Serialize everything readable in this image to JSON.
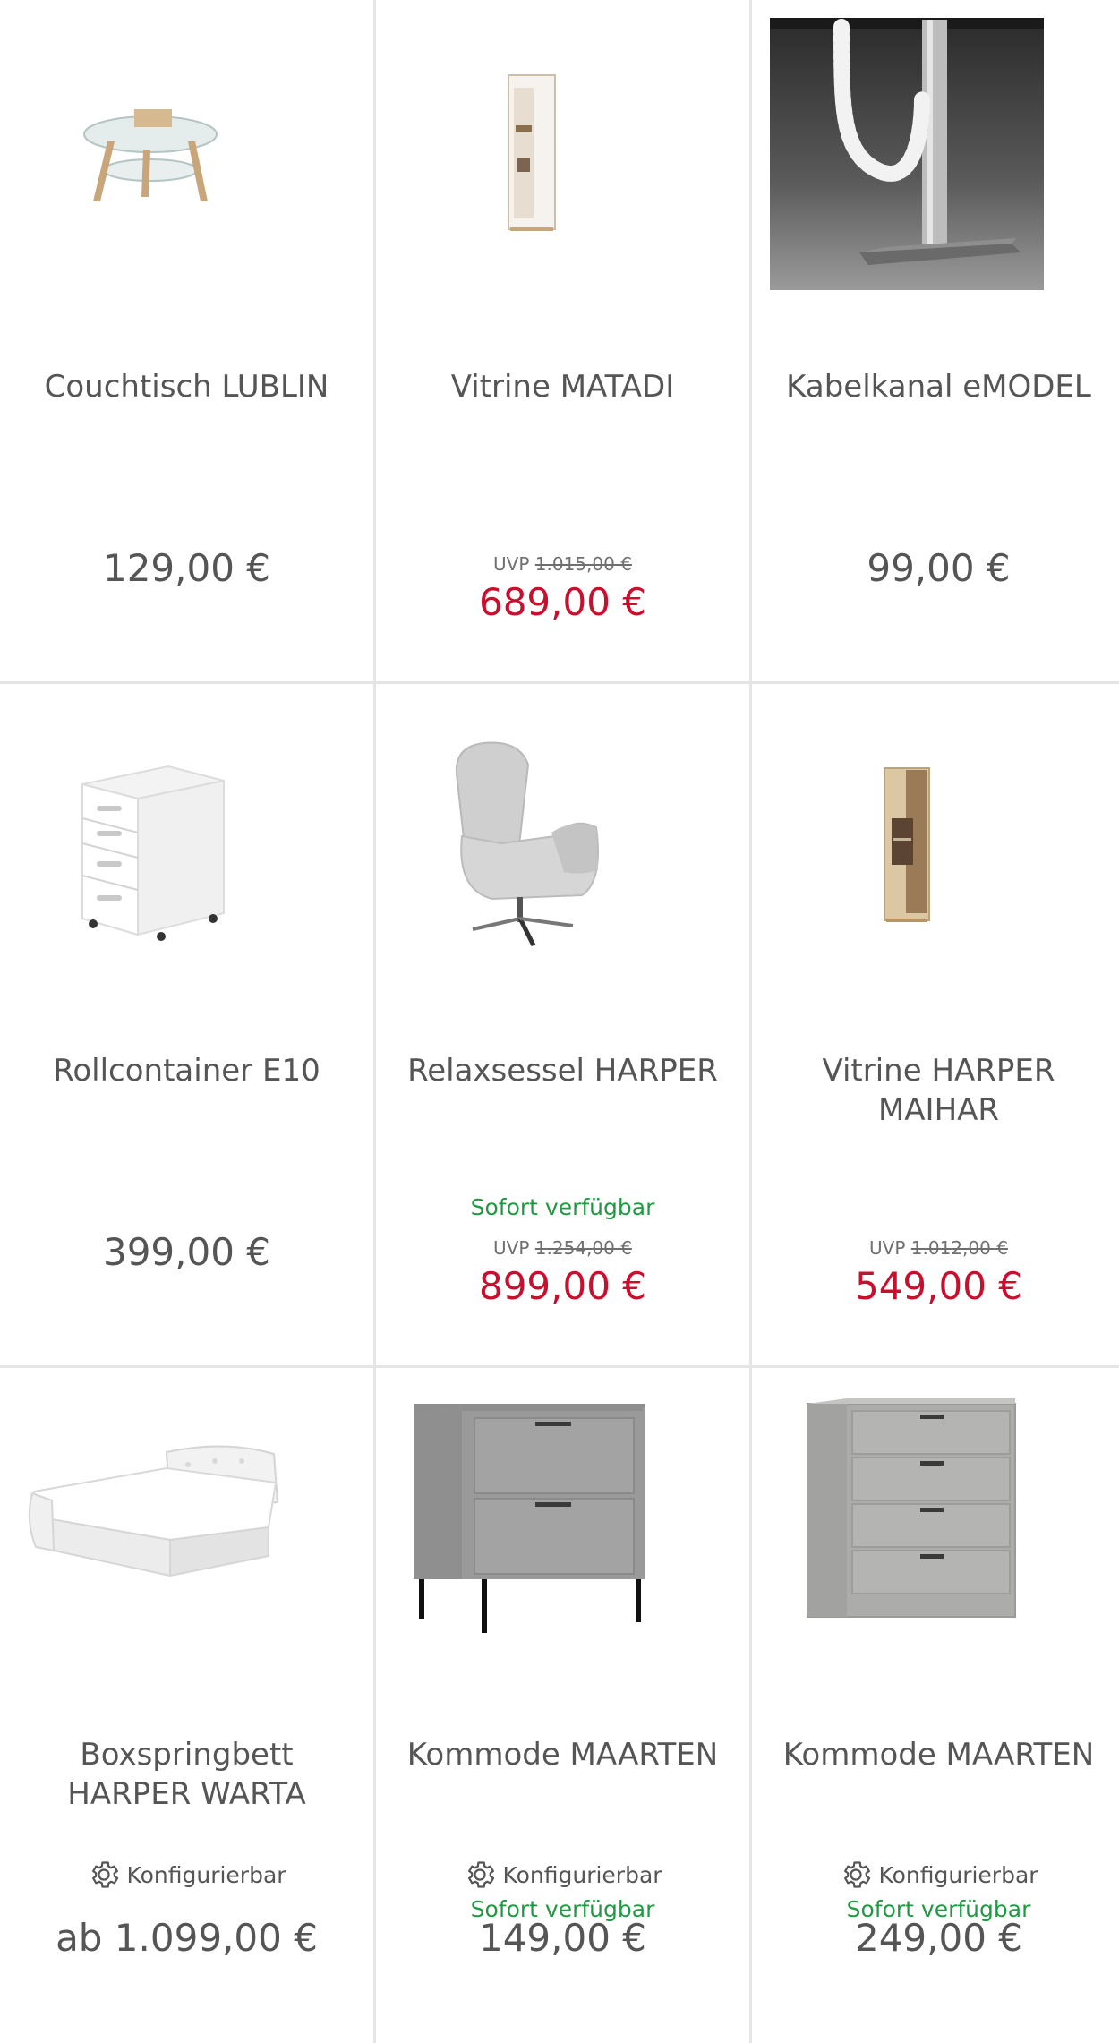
{
  "colors": {
    "sale": "#c8102e",
    "available": "#1f9a42",
    "text": "#555555",
    "divider": "#e5e5e5"
  },
  "labels": {
    "uvp": "UVP",
    "configurable": "Konfigurierbar",
    "available": "Sofort verfügbar"
  },
  "products": [
    {
      "title": "Couchtisch LUBLIN",
      "price": "129,00 €",
      "image": "glass-coffee-table"
    },
    {
      "title": "Vitrine MATADI",
      "uvp_price": "1.015,00 €",
      "sale_price": "689,00 €",
      "image": "white-display-cabinet"
    },
    {
      "title": "Kabelkanal eMODEL",
      "price": "99,00 €",
      "image": "cable-duct-photo"
    },
    {
      "title": "Rollcontainer E10",
      "price": "399,00 €",
      "image": "white-drawer-container"
    },
    {
      "title": "Relaxsessel HARPER",
      "availability": "Sofort verfügbar",
      "uvp_price": "1.254,00 €",
      "sale_price": "899,00 €",
      "image": "grey-recliner-chair"
    },
    {
      "title": "Vitrine HARPER MAIHAR",
      "uvp_price": "1.012,00 €",
      "sale_price": "549,00 €",
      "image": "oak-display-cabinet"
    },
    {
      "title": "Boxspringbett HARPER WARTA",
      "configurable": "Konfigurierbar",
      "price": "ab 1.099,00 €",
      "image": "white-boxspring-bed"
    },
    {
      "title": "Kommode MAARTEN",
      "configurable": "Konfigurierbar",
      "availability": "Sofort verfügbar",
      "price": "149,00 €",
      "image": "grey-nightstand"
    },
    {
      "title": "Kommode MAARTEN",
      "configurable": "Konfigurierbar",
      "availability": "Sofort verfügbar",
      "price": "249,00 €",
      "image": "grey-chest-of-drawers"
    }
  ]
}
